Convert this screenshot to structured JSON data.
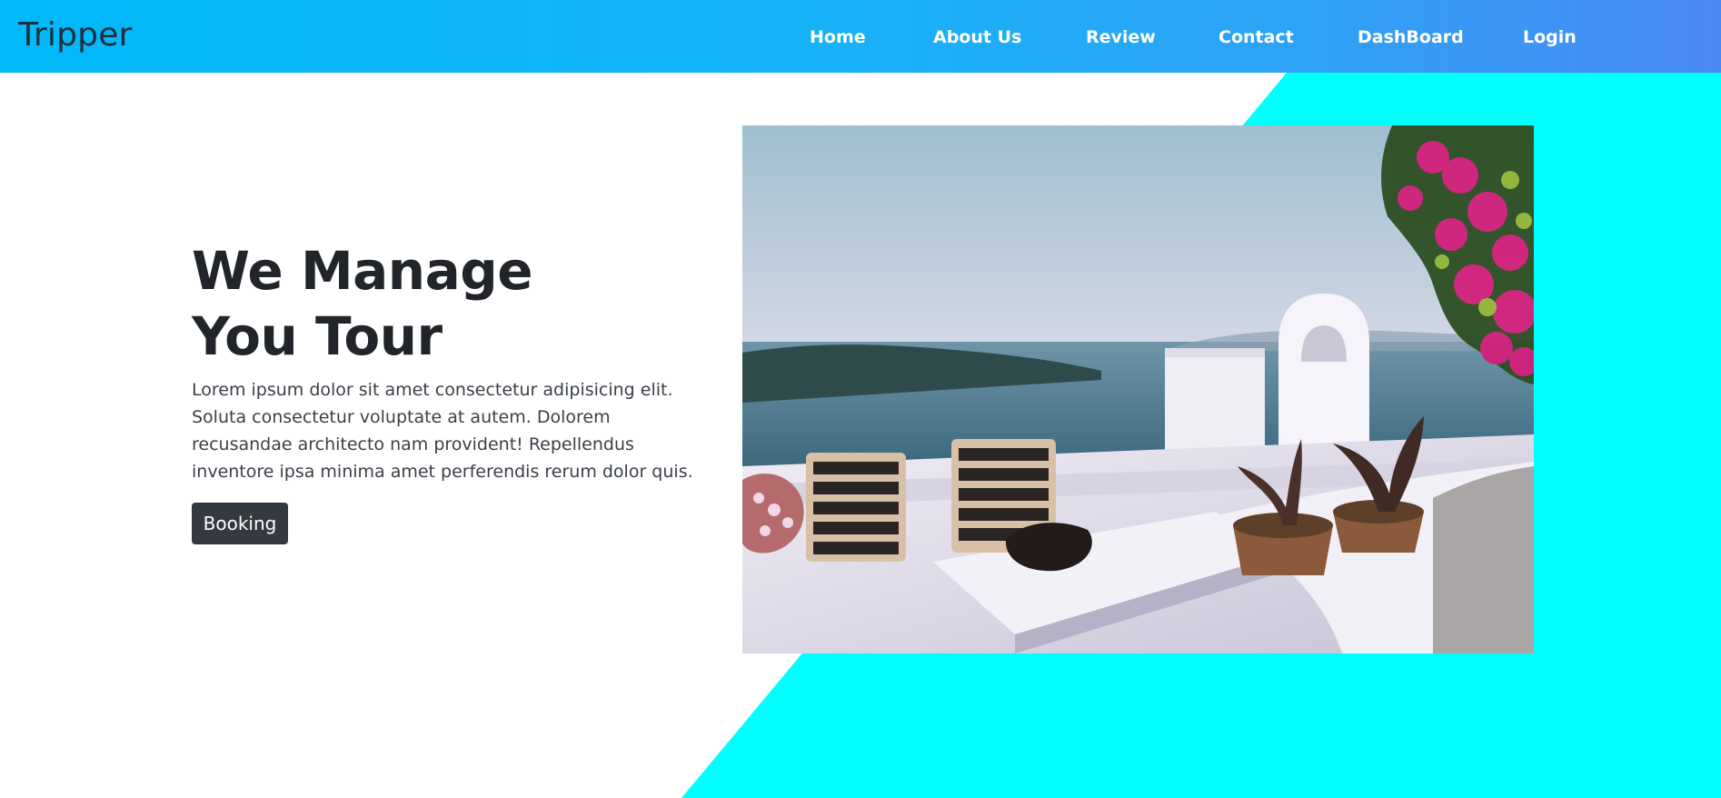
{
  "navbar": {
    "brand": "Tripper",
    "links": [
      {
        "label": "Home"
      },
      {
        "label": "About Us"
      },
      {
        "label": "Review"
      },
      {
        "label": "Contact"
      },
      {
        "label": "DashBoard"
      },
      {
        "label": "Login"
      }
    ]
  },
  "hero": {
    "title_line1": "We Manage",
    "title_line2": "You Tour",
    "description": "Lorem ipsum dolor sit amet consectetur adipisicing elit. Soluta consectetur voluptate at autem. Dolorem recusandae architecto nam provident! Repellendus inventore ipsa minima amet perferendis rerum dolor quis.",
    "button_label": "Booking",
    "image_name": "santorini-balcony-photo"
  },
  "colors": {
    "navbar_start": "#00b9f8",
    "navbar_end": "#4a89f3",
    "cyan_accent": "#00ffff",
    "button_bg": "#343a40",
    "heading_text": "#212529"
  }
}
